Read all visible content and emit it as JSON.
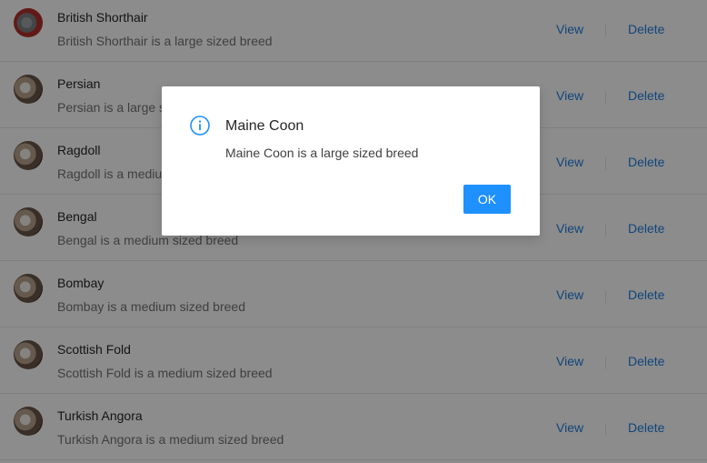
{
  "list": {
    "view_label": "View",
    "delete_label": "Delete",
    "items": [
      {
        "title": "British Shorthair",
        "description": "British Shorthair is a large sized breed",
        "avatar": "red"
      },
      {
        "title": "Persian",
        "description": "Persian is a large sized breed",
        "avatar": "cat"
      },
      {
        "title": "Ragdoll",
        "description": "Ragdoll is a medium sized breed",
        "avatar": "cat"
      },
      {
        "title": "Bengal",
        "description": "Bengal is a medium sized breed",
        "avatar": "cat"
      },
      {
        "title": "Bombay",
        "description": "Bombay is a medium sized breed",
        "avatar": "cat"
      },
      {
        "title": "Scottish Fold",
        "description": "Scottish Fold is a medium sized breed",
        "avatar": "cat"
      },
      {
        "title": "Turkish Angora",
        "description": "Turkish Angora is a medium sized breed",
        "avatar": "cat"
      }
    ]
  },
  "modal": {
    "icon": "info-icon",
    "title": "Maine Coon",
    "content": "Maine Coon is a large sized breed",
    "ok_label": "OK",
    "accent_color": "#1e90ff"
  }
}
